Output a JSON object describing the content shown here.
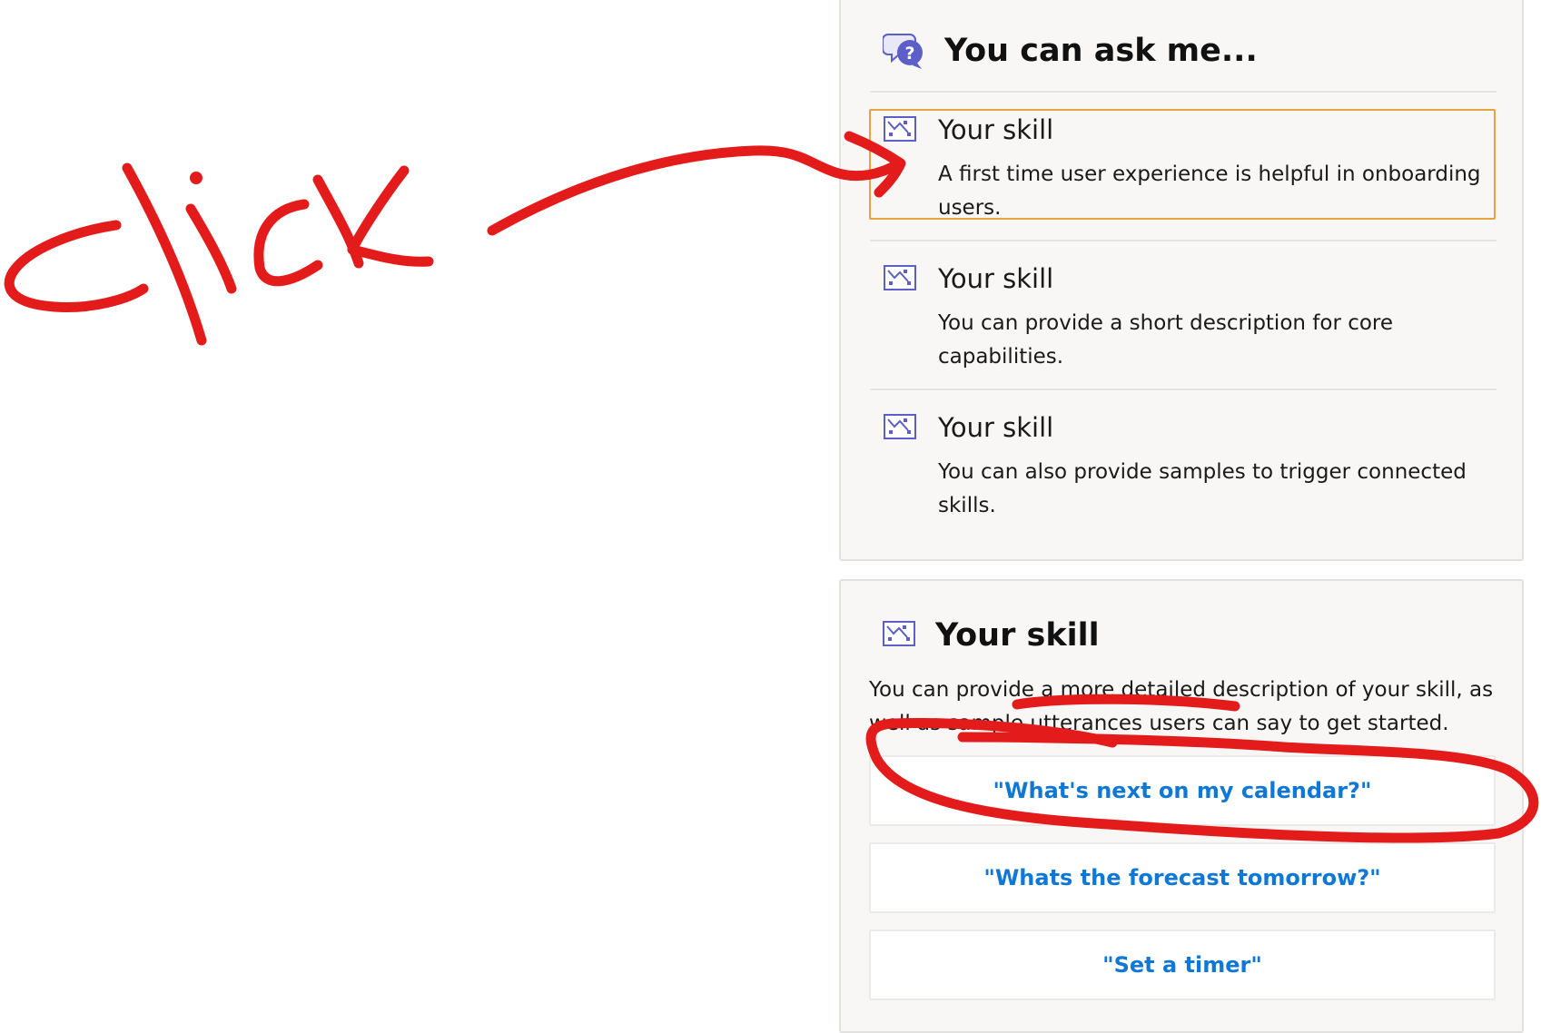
{
  "ask_card": {
    "title": "You can ask me...",
    "header_icon": "chat-question-icon",
    "items": [
      {
        "icon": "image-placeholder-icon",
        "title": "Your skill",
        "description": "A first time user experience is helpful in onboarding users."
      },
      {
        "icon": "image-placeholder-icon",
        "title": "Your skill",
        "description": "You can provide a short description for core capabilities."
      },
      {
        "icon": "image-placeholder-icon",
        "title": "Your skill",
        "description": "You can also provide samples to trigger connected skills."
      }
    ]
  },
  "skill_card": {
    "icon": "image-placeholder-icon",
    "title": "Your skill",
    "intro": "You can provide a more detailed description of your skill, as well as sample utterances users can say to get started.",
    "samples": [
      "\"What's next on my calendar?\"",
      "\"Whats the forecast tomorrow?\"",
      "\"Set a timer\""
    ]
  },
  "annotation": {
    "text": "click",
    "color": "#e31b1b"
  },
  "colors": {
    "focus_border": "#e8a33c",
    "link_blue": "#0f78d4",
    "icon_purple": "#5b5fc7",
    "card_bg": "#f8f7f6"
  }
}
